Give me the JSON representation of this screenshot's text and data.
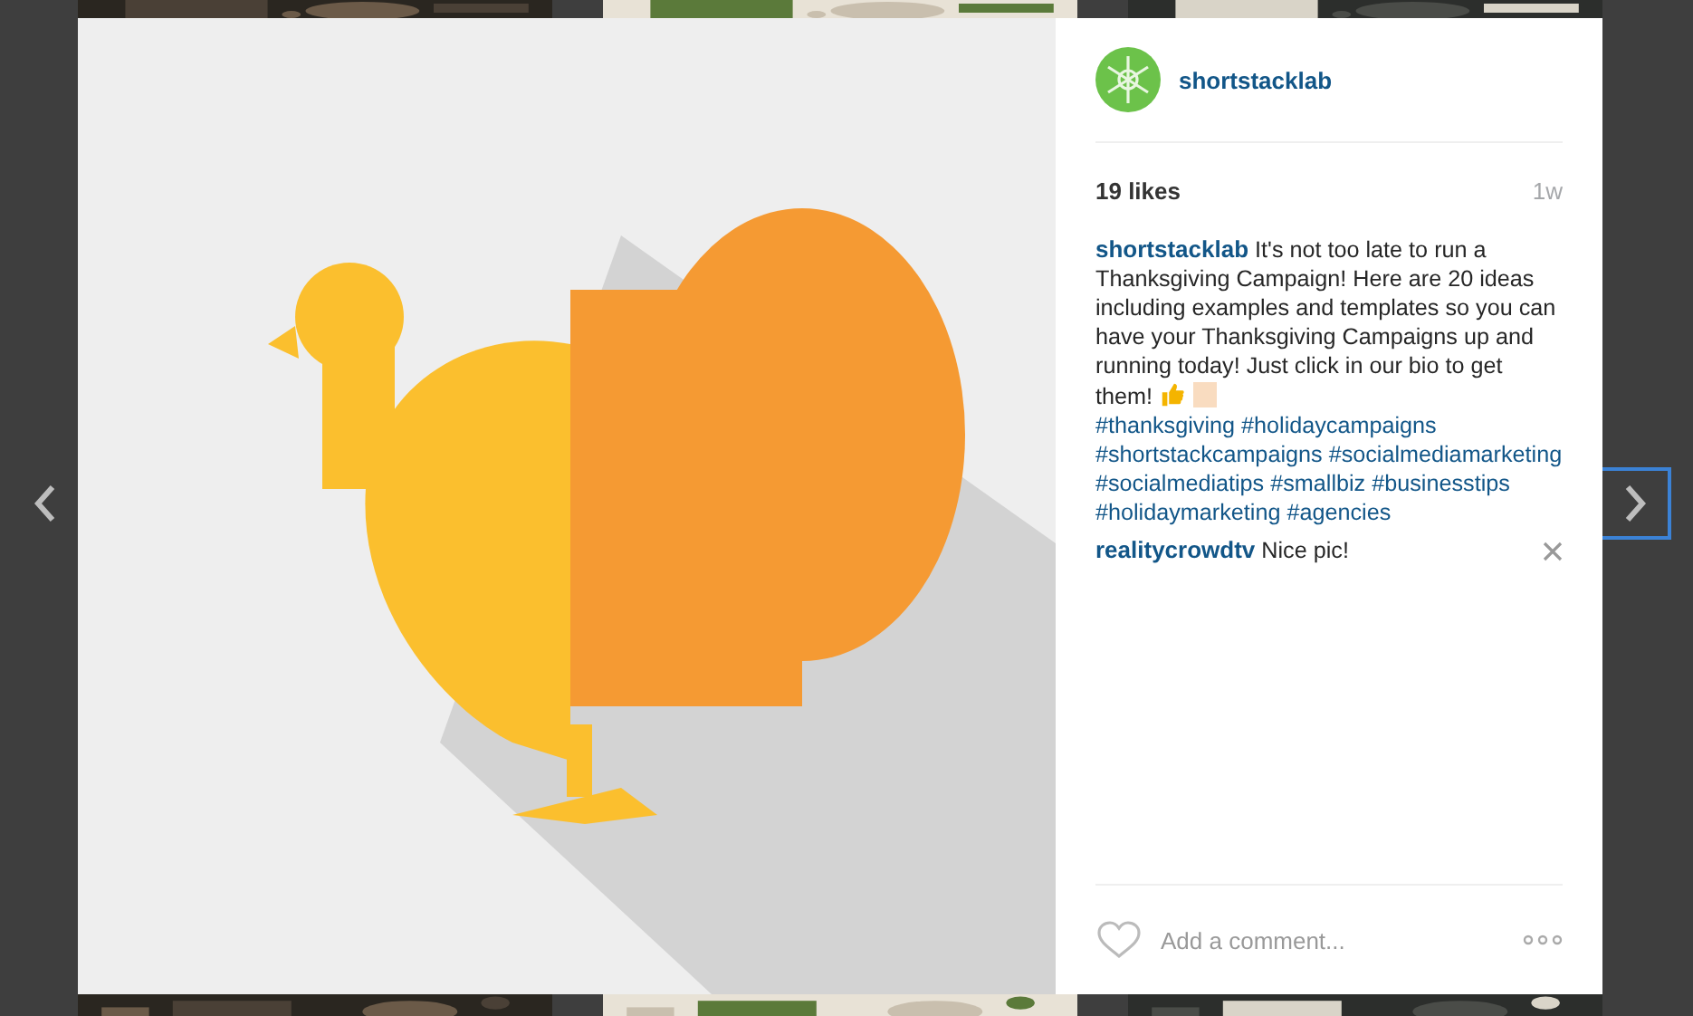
{
  "post": {
    "author": "shortstacklab",
    "likes": "19 likes",
    "age": "1w",
    "caption": {
      "user": "shortstacklab",
      "text": "It's not too late to run a Thanksgiving Campaign! Here are 20 ideas including examples and templates so you can have your Thanksgiving Campaigns up and running today! Just click in our bio to get them!",
      "hashtags": [
        "#thanksgiving",
        "#holidaycampaigns",
        "#shortstackcampaigns",
        "#socialmediamarketing",
        "#socialmediatips",
        "#smallbiz",
        "#businesstips",
        "#holidaymarketing",
        "#agencies"
      ]
    },
    "comments": [
      {
        "user": "realitycrowdtv",
        "text": "Nice pic!"
      }
    ],
    "comment_field": {
      "placeholder": "Add a comment..."
    }
  },
  "nav": {
    "next_focused": true
  }
}
